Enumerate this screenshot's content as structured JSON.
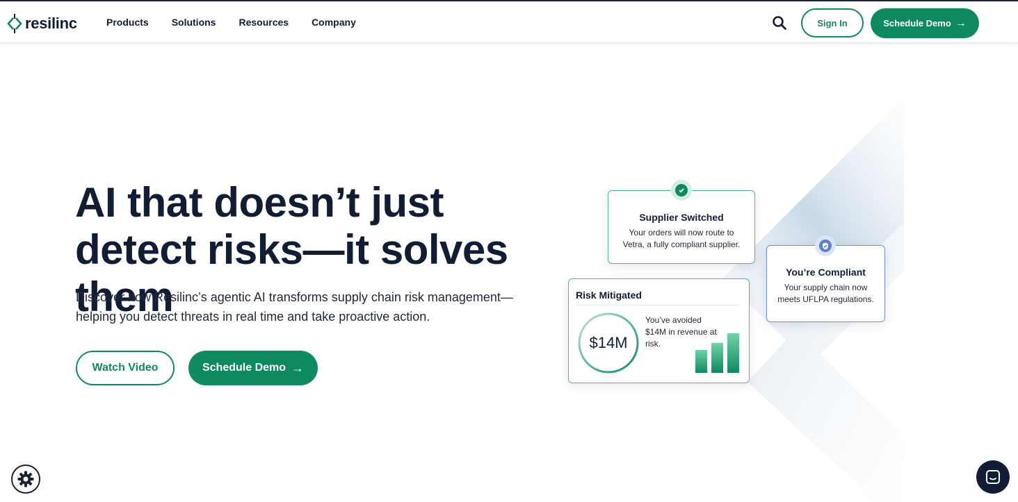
{
  "header": {
    "logo_text": "resilinc",
    "nav": [
      "Products",
      "Solutions",
      "Resources",
      "Company"
    ],
    "search_icon": "search-icon",
    "signin_label": "Sign In",
    "demo_label": "Schedule Demo",
    "demo_arrow": "→"
  },
  "hero": {
    "title": "AI that doesn’t just detect risks—it solves them",
    "subtitle": "Discover how Resilinc’s agentic AI transforms supply chain risk management—helping you detect threats in real time and take proactive action.",
    "watch_label": "Watch Video",
    "demo_label": "Schedule Demo",
    "demo_arrow": "→"
  },
  "cards": {
    "supplier": {
      "title": "Supplier Switched",
      "body": "Your orders will now route to Vetra, a fully compliant supplier.",
      "icon": "check-badge-icon"
    },
    "compliant": {
      "title": "You’re Compliant",
      "body": "Your supply chain now meets UFLPA regulations.",
      "icon": "shield-check-icon"
    },
    "risk": {
      "title": "Risk Mitigated",
      "value": "$14M",
      "body": "You’ve avoided $14M in revenue at risk.",
      "bar_levels": [
        0.55,
        0.72,
        0.95
      ]
    }
  },
  "floating": {
    "settings_icon": "gear-icon",
    "chat_icon": "chat-icon"
  },
  "colors": {
    "brand_green": "#0f8a5f",
    "navy": "#111d35",
    "accent_blue": "#5b7fd1"
  }
}
